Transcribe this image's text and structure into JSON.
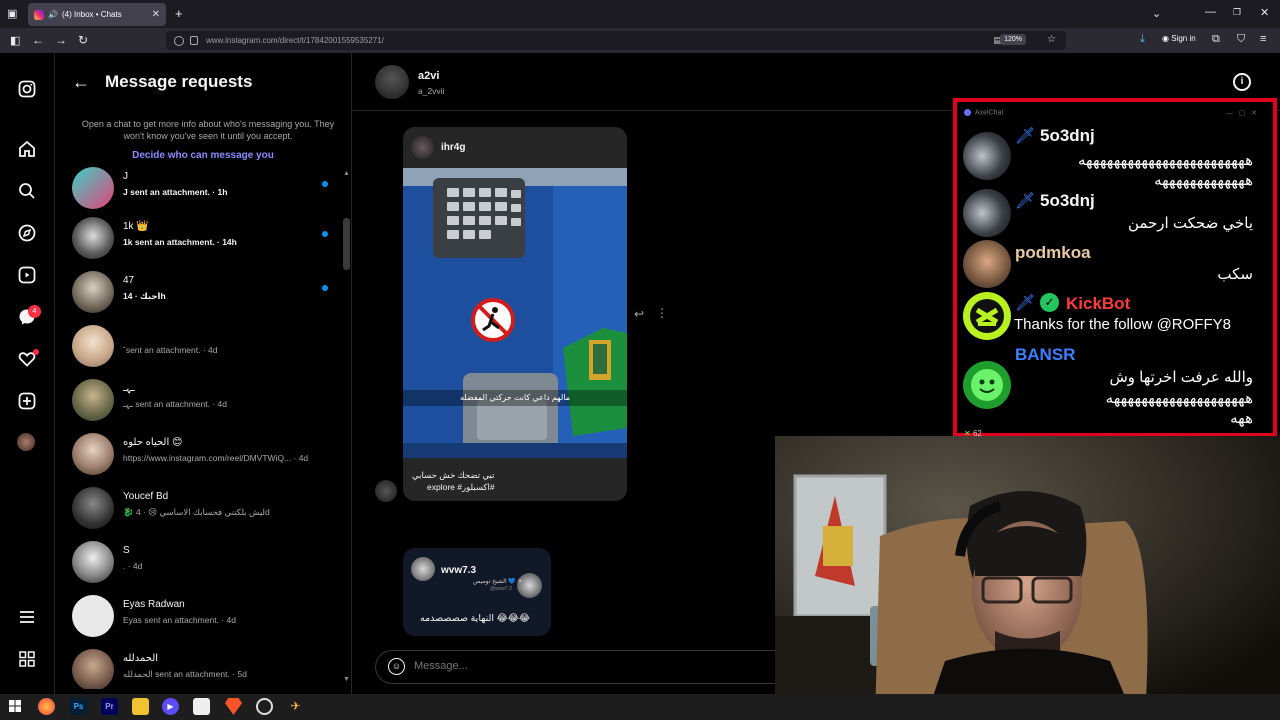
{
  "browser": {
    "tab_title": "(4) Inbox • Chats",
    "tab_close": "✕",
    "new_tab": "+",
    "url": "www.instagram.com/direct/t/17842001559535271/",
    "zoom": "120%",
    "signin": "Sign in"
  },
  "rail": {
    "notifications_badge": "4"
  },
  "requests": {
    "title": "Message requests",
    "note": "Open a chat to get more info about who's messaging you. They won't know you've seen it until you accept.",
    "link": "Decide who can message you",
    "rows": [
      {
        "name": "J",
        "sub": "J sent an attachment. · 1h",
        "unread": true
      },
      {
        "name": "1k 👑",
        "sub": "1k sent an attachment. · 14h",
        "unread": true
      },
      {
        "name": "47",
        "sub": "احبك · 14h",
        "unread": true
      },
      {
        "name": "",
        "sub": "ˇsent an attachment. · 4d",
        "unread": false
      },
      {
        "name": "ـہـ",
        "sub": "ـہـ sent an attachment. · 4d",
        "unread": false
      },
      {
        "name": "الحياه حلوه 😊",
        "sub": "https://www.instagram.com/reel/DMVTWiQ... · 4d",
        "unread": false
      },
      {
        "name": "Youcef Bd",
        "sub": "🐉 ليش بلكتني فحسابك الاساسي 😢 · 4d",
        "unread": false
      },
      {
        "name": "S",
        "sub": ". · 4d",
        "unread": false
      },
      {
        "name": "Eyas Radwan",
        "sub": "Eyas sent an attachment. · 4d",
        "unread": false
      },
      {
        "name": "الحمدلله",
        "sub": "الحمدلله sent an attachment. · 5d",
        "unread": false
      }
    ]
  },
  "chat": {
    "name": "a2vi",
    "handle": "a_2vvii",
    "info": "i",
    "post1": {
      "user": "ihr4g",
      "overlay": "مالهم داعي كانت حركتي المفضله",
      "caption_line1": "تبي تضحك خش حسابي",
      "caption_line2": "explore #اكسبلور#"
    },
    "post2": {
      "user": "wvw7.3",
      "meta1": "الشيخ توميس 💙 ✈",
      "meta2": "@wvw7.3",
      "text": "النهاية صصصصدمه 😂😂😂"
    },
    "message_placeholder": "Message..."
  },
  "axel": {
    "title": "AxelChat",
    "messages": [
      {
        "user": "5o3dnj",
        "user_color": "#3d7fff",
        "lines": [
          "ههههههههههههههههههههههههه",
          "هههههههههههههه"
        ]
      },
      {
        "user": "5o3dnj",
        "user_color": "#3d7fff",
        "lines": [
          "ياخي ضحكت ارحمن"
        ]
      },
      {
        "user": "podmkoa",
        "user_color": "#e8c9a0",
        "lines": [
          "سكب"
        ]
      },
      {
        "user": "KickBot",
        "user_color": "#ff3b3b",
        "lines": [
          "Thanks for the follow @ROFFY8"
        ]
      },
      {
        "user": "BANSR",
        "user_color": "#3d7fff",
        "lines": [
          "والله عرفت اخرتها وش",
          "ههههههههههههههههههههه",
          "ههه"
        ]
      }
    ],
    "viewer_count": "62"
  },
  "taskbar": {
    "icons": [
      "windows-start",
      "firefox",
      "photoshop",
      "premiere",
      "file-explorer",
      "streamlabs",
      "store",
      "brave",
      "obs",
      "app"
    ]
  }
}
